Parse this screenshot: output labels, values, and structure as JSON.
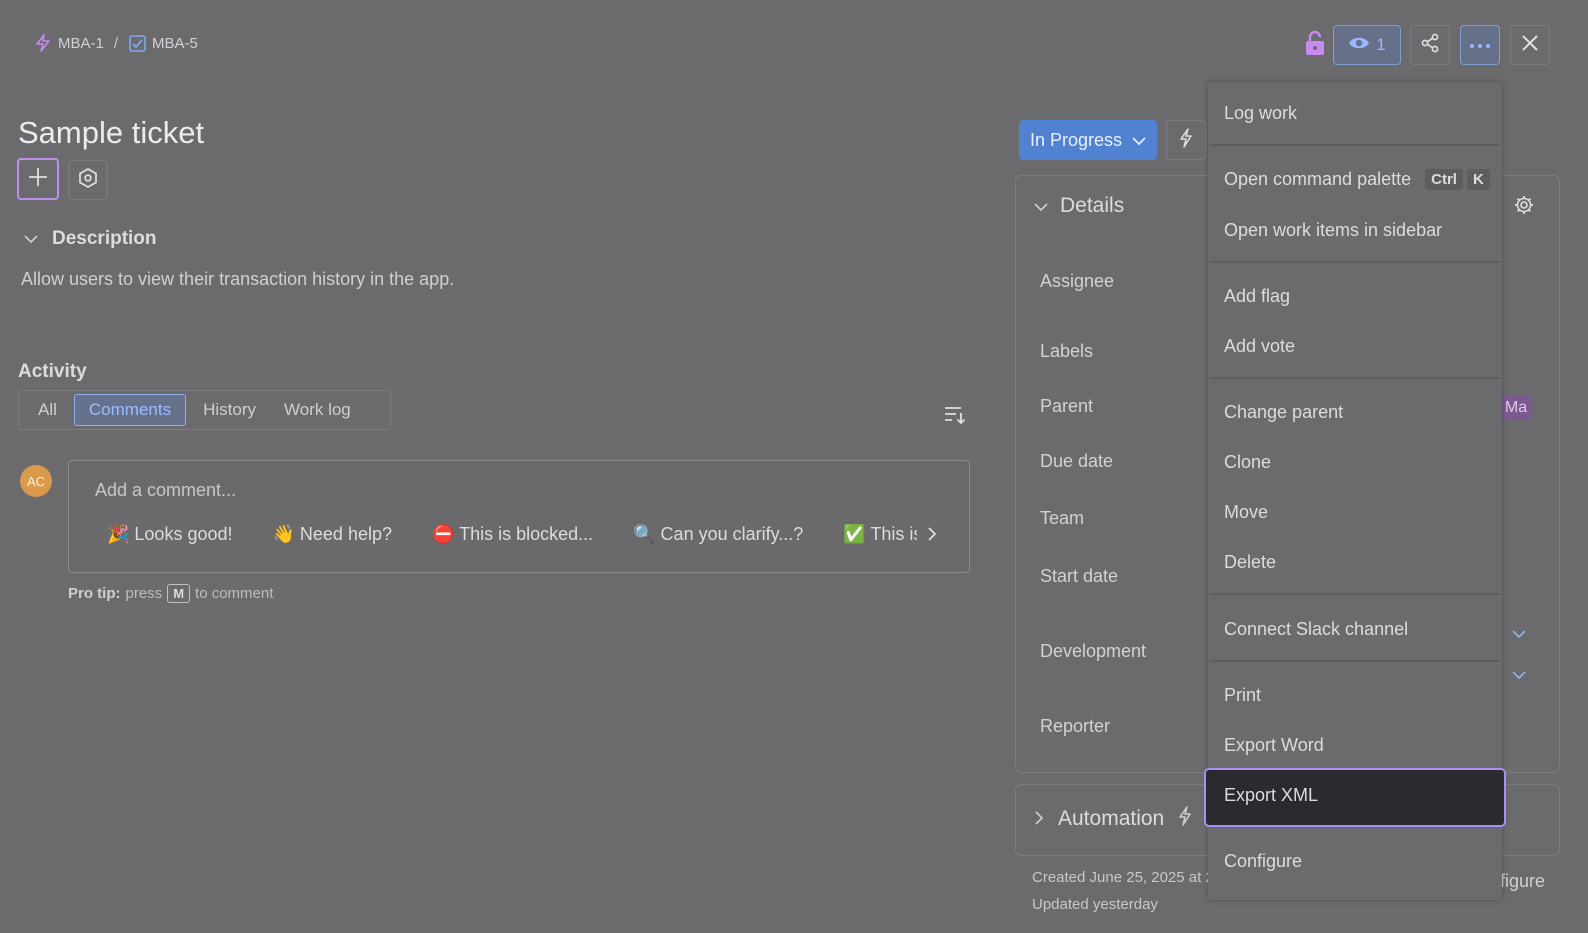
{
  "breadcrumb": {
    "parent_key": "MBA-1",
    "separator": "/",
    "item_key": "MBA-5"
  },
  "header": {
    "watch_count": "1"
  },
  "ticket": {
    "title": "Sample ticket"
  },
  "description": {
    "heading": "Description",
    "text": "Allow users to view their transaction history in the app."
  },
  "activity": {
    "heading": "Activity",
    "tabs": [
      {
        "label": "All"
      },
      {
        "label": "Comments",
        "active": true
      },
      {
        "label": "History"
      },
      {
        "label": "Work log"
      }
    ]
  },
  "comment": {
    "avatar_initials": "AC",
    "placeholder": "Add a comment...",
    "quick_replies": [
      "🎉 Looks good!",
      "👋 Need help?",
      "⛔ This is blocked...",
      "🔍 Can you clarify...?",
      "✅ This is on track"
    ],
    "protip_bold": "Pro tip:",
    "protip_press": "press",
    "protip_key": "M",
    "protip_tail": "to comment"
  },
  "status": {
    "label": "In Progress"
  },
  "details": {
    "heading": "Details",
    "fields": [
      "Assignee",
      "Labels",
      "Parent",
      "Due date",
      "Team",
      "Start date",
      "Development",
      "Reporter"
    ],
    "parent_badge": "Ma"
  },
  "automation": {
    "heading": "Automation"
  },
  "footer": {
    "created": "Created June 25, 2025 at 2",
    "updated": "Updated yesterday",
    "configure": "figure"
  },
  "menu": {
    "log_work": "Log work",
    "open_command_palette": "Open command palette",
    "kbd_ctrl": "Ctrl",
    "kbd_k": "K",
    "open_in_sidebar": "Open work items in sidebar",
    "add_flag": "Add flag",
    "add_vote": "Add vote",
    "change_parent": "Change parent",
    "clone": "Clone",
    "move": "Move",
    "delete": "Delete",
    "connect_slack": "Connect Slack channel",
    "print": "Print",
    "export_word": "Export Word",
    "export_xml": "Export XML",
    "configure": "Configure"
  },
  "colors": {
    "status_blue": "#5182d1",
    "focus_purple": "#a98ef7",
    "selected_bg": "#2b2b2f"
  }
}
